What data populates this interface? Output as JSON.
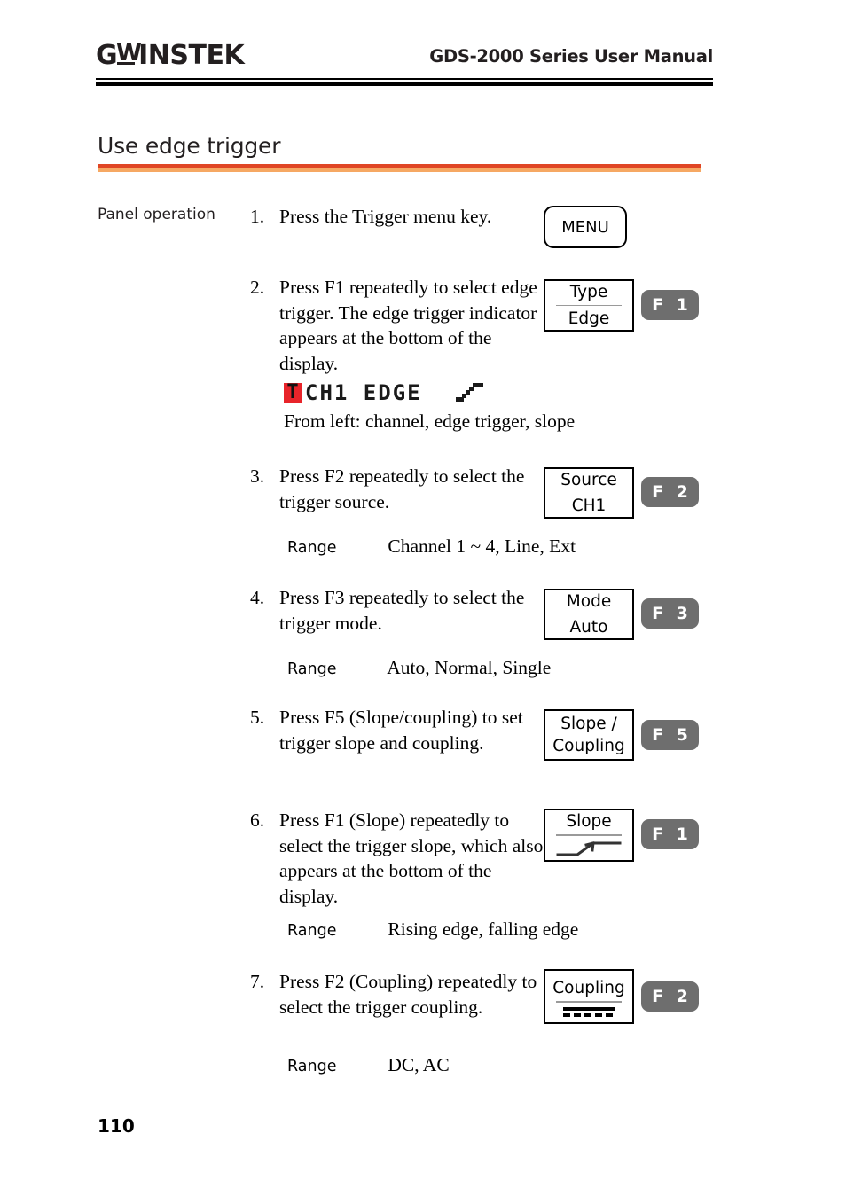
{
  "header": {
    "logo_g": "G",
    "logo_w": "W",
    "logo_instek": "INSTEK",
    "manual_title": "GDS-2000 Series User Manual"
  },
  "section": {
    "heading": "Use edge trigger",
    "rule_dark_color": "#e04625",
    "rule_light_color": "#f6a863"
  },
  "body": {
    "side_label": "Panel operation"
  },
  "steps": [
    {
      "number": "1.",
      "text": "Press the Trigger menu key.",
      "key": {
        "type": "menu",
        "label": "MENU"
      }
    },
    {
      "number": "2.",
      "text": "Press F1 repeatedly to select edge trigger. The edge trigger indicator appears at the bottom of the display.",
      "softkey": {
        "top": "Type",
        "bottom": "Edge"
      },
      "fkey": "F 1"
    },
    {
      "number": "3.",
      "text": "Press F2 repeatedly to select the trigger source.",
      "softkey": {
        "top": "Source",
        "bottom": "CH1"
      },
      "fkey": "F 2",
      "range": {
        "label": "Range",
        "value": "Channel 1 ~ 4, Line, Ext"
      }
    },
    {
      "number": "4.",
      "text": "Press F3 repeatedly to select the trigger mode.",
      "softkey": {
        "top": "Mode",
        "bottom": "Auto"
      },
      "fkey": "F 3",
      "range": {
        "label": "Range",
        "value": "Auto, Normal, Single"
      }
    },
    {
      "number": "5.",
      "text": "Press F5 (Slope/coupling) to set trigger slope and coupling.",
      "softkey": {
        "top": "Slope /",
        "bottom": "Coupling",
        "divider": false
      },
      "fkey": "F 5"
    },
    {
      "number": "6.",
      "text": "Press F1 (Slope) repeatedly to select the trigger slope, which also appears at the bottom of the display.",
      "softkey": {
        "top": "Slope",
        "graphic": "rising-edge-slope"
      },
      "fkey": "F 1",
      "range": {
        "label": "Range",
        "value": "Rising edge, falling edge"
      }
    },
    {
      "number": "7.",
      "text": "Press F2 (Coupling) repeatedly to select the trigger coupling.",
      "softkey": {
        "top": "Coupling",
        "graphic": "dc-coupling"
      },
      "fkey": "F 2",
      "range": {
        "label": "Range",
        "value": "DC, AC"
      }
    }
  ],
  "trigger_indicator": {
    "t_glyph": "T",
    "t_background": "#e8242a",
    "text": "CH1 EDGE",
    "slope_symbol": "rising-edge",
    "caption": "From left: channel, edge trigger, slope"
  },
  "footer": {
    "page_number": "110"
  }
}
